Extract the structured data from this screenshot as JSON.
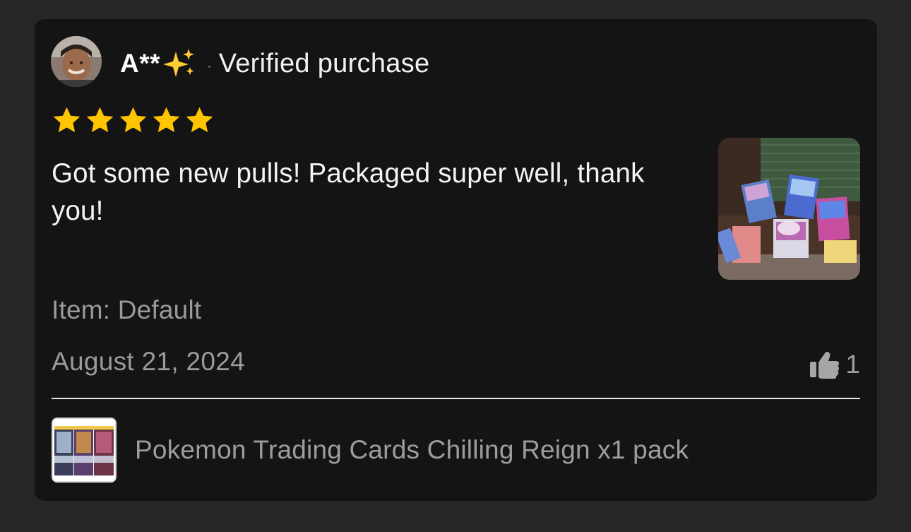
{
  "review": {
    "reviewer_name": "A**",
    "reviewer_badge_icon": "sparkles-icon",
    "separator": "·",
    "verified_label": "Verified purchase",
    "rating": 5,
    "rating_max": 5,
    "text": "Got some new pulls! Packaged super well, thank you!",
    "item_variant": "Item: Default",
    "date": "August 21, 2024",
    "helpful_count": "1",
    "helpful_icon": "thumbs-up-icon"
  },
  "product": {
    "name": "Pokemon Trading Cards Chilling Reign x1 pack"
  },
  "colors": {
    "background": "#262626",
    "card": "#141414",
    "star": "#FFC500",
    "primary_text": "#F4F4F4",
    "secondary_text": "#9A9A9A"
  }
}
